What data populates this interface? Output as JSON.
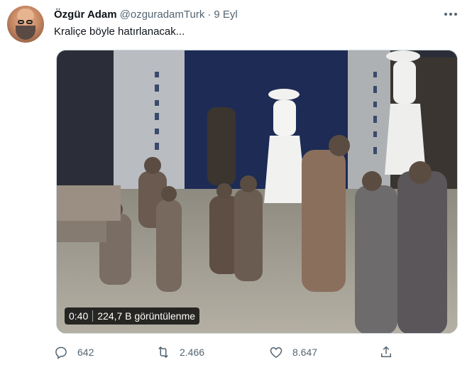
{
  "tweet": {
    "display_name": "Özgür Adam",
    "handle": "@ozguradamTurk",
    "separator": "·",
    "date": "9 Eyl",
    "text": "Kraliçe böyle hatırlanacak..."
  },
  "media": {
    "duration": "0:40",
    "views": "224,7 B görüntülenme"
  },
  "actions": {
    "replies": "642",
    "retweets": "2.466",
    "likes": "8.647"
  },
  "icons": {
    "more": "more-horizontal-icon",
    "reply": "reply-icon",
    "retweet": "retweet-icon",
    "like": "heart-icon",
    "share": "share-icon"
  },
  "colors": {
    "text_primary": "#0f1419",
    "text_secondary": "#536471",
    "border": "#cfd9de"
  }
}
